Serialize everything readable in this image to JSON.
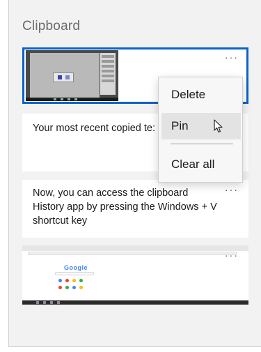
{
  "panel": {
    "title": "Clipboard"
  },
  "items": [
    {
      "type": "image",
      "more_label": "···",
      "selected": true
    },
    {
      "type": "text",
      "text": "Your most recent copied te:"
    },
    {
      "type": "text",
      "text": "Now, you can access the clipboard History app by pressing the Windows + V shortcut key",
      "more_label": "···"
    },
    {
      "type": "image",
      "more_label": "···"
    }
  ],
  "thumbnail": {
    "logo": "Google"
  },
  "context_menu": {
    "items": [
      "Delete",
      "Pin",
      "Clear all"
    ],
    "hovered": "Pin"
  },
  "colors": {
    "accent": "#0a62c8",
    "panel_bg": "#f2f2f2",
    "menu_bg": "#f7f7f7"
  }
}
